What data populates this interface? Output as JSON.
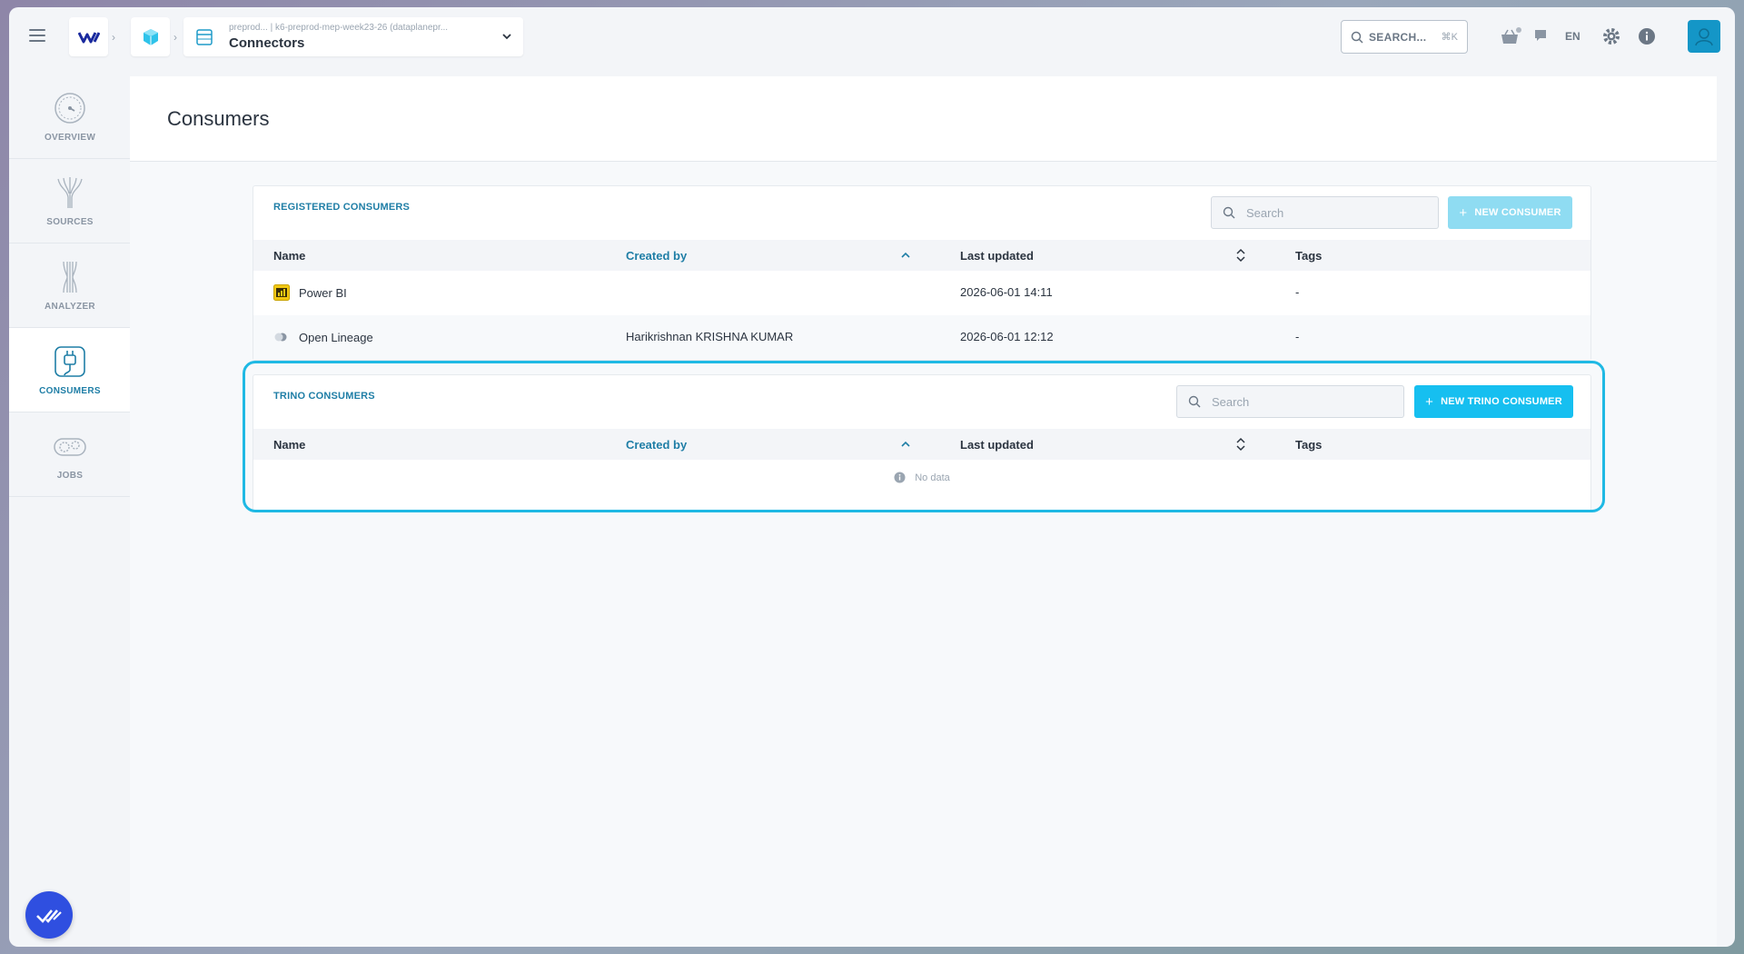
{
  "topbar": {
    "breadcrumb_sub": "preprod...  | k6-preprod-mep-week23-26 (dataplanepr...",
    "breadcrumb_title": "Connectors",
    "search_label": "SEARCH...",
    "search_shortcut": "⌘K",
    "language": "EN"
  },
  "sidebar": {
    "items": [
      {
        "label": "OVERVIEW",
        "icon": "gauge-icon",
        "active": false
      },
      {
        "label": "SOURCES",
        "icon": "sources-icon",
        "active": false
      },
      {
        "label": "ANALYZER",
        "icon": "analyzer-icon",
        "active": false
      },
      {
        "label": "CONSUMERS",
        "icon": "plug-icon",
        "active": true
      },
      {
        "label": "JOBS",
        "icon": "gears-icon",
        "active": false
      }
    ]
  },
  "page": {
    "title": "Consumers"
  },
  "registered": {
    "title": "REGISTERED CONSUMERS",
    "search_placeholder": "Search",
    "new_button": "NEW CONSUMER",
    "columns": {
      "name": "Name",
      "created_by": "Created by",
      "last_updated": "Last updated",
      "tags": "Tags"
    },
    "rows": [
      {
        "name": "Power BI",
        "icon": "powerbi-icon",
        "created_by": "",
        "last_updated": "2026-06-01 14:11",
        "tags": "-"
      },
      {
        "name": "Open Lineage",
        "icon": "openlineage-icon",
        "created_by": "Harikrishnan KRISHNA KUMAR",
        "last_updated": "2026-06-01 12:12",
        "tags": "-"
      }
    ]
  },
  "trino": {
    "title": "TRINO CONSUMERS",
    "search_placeholder": "Search",
    "new_button": "NEW TRINO CONSUMER",
    "columns": {
      "name": "Name",
      "created_by": "Created by",
      "last_updated": "Last updated",
      "tags": "Tags"
    },
    "empty_text": "No data"
  },
  "colors": {
    "accent": "#16bff0",
    "accent_disabled": "#8fdcf2",
    "link": "#1f7ea6",
    "highlight_border": "#1fb9e4"
  }
}
